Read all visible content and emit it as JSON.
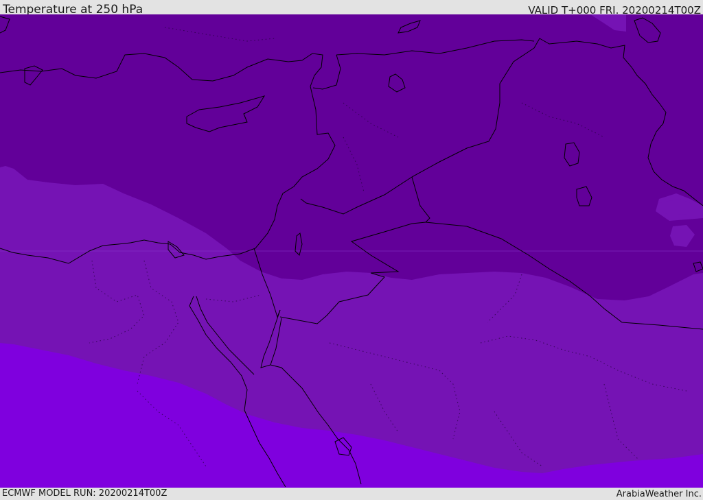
{
  "header": {
    "title": "Temperature at 250 hPa",
    "valid": "VALID T+000 FRI. 20200214T00Z"
  },
  "footer": {
    "model_run": "ECMWF MODEL RUN: 20200214T00Z",
    "credit": "ArabiaWeather Inc."
  },
  "colors": {
    "coldest_band": "#620099",
    "middle_band": "#7513b4",
    "warmest_band": "#7f00de",
    "coastline": "#000000",
    "background": "#e3e3e3"
  }
}
